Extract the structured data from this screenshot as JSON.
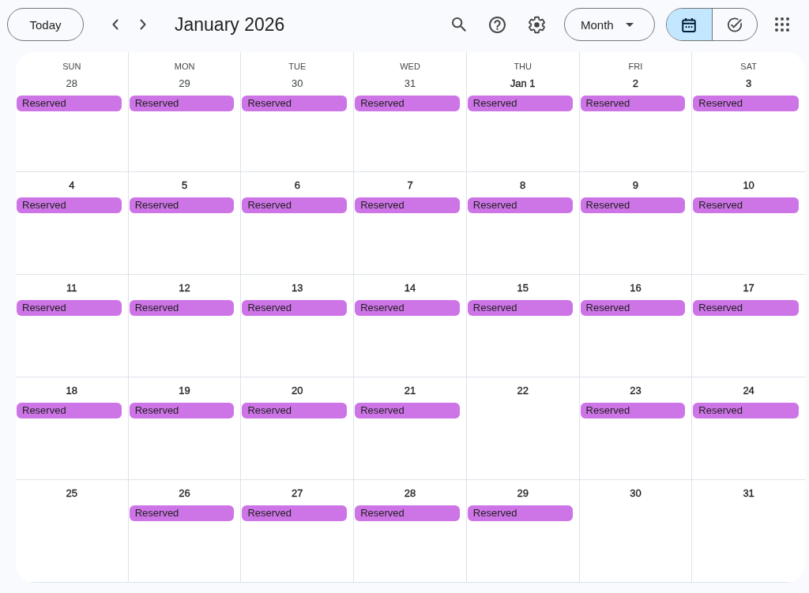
{
  "toolbar": {
    "today_button": "Today",
    "title": "January 2026",
    "view_dropdown": "Month",
    "view_toggle": [
      {
        "kind": "calendar",
        "selected": true
      },
      {
        "kind": "tasks",
        "selected": false
      }
    ]
  },
  "month_grid": {
    "weekdays": [
      "SUN",
      "MON",
      "TUE",
      "WED",
      "THU",
      "FRI",
      "SAT"
    ],
    "weeks": [
      [
        {
          "date": "28",
          "in_month": false,
          "events": [
            "Reserved"
          ]
        },
        {
          "date": "29",
          "in_month": false,
          "events": [
            "Reserved"
          ]
        },
        {
          "date": "30",
          "in_month": false,
          "events": [
            "Reserved"
          ]
        },
        {
          "date": "31",
          "in_month": false,
          "events": [
            "Reserved"
          ]
        },
        {
          "date": "Jan 1",
          "in_month": true,
          "events": [
            "Reserved"
          ]
        },
        {
          "date": "2",
          "in_month": true,
          "events": [
            "Reserved"
          ]
        },
        {
          "date": "3",
          "in_month": true,
          "events": [
            "Reserved"
          ]
        }
      ],
      [
        {
          "date": "4",
          "in_month": true,
          "events": [
            "Reserved"
          ]
        },
        {
          "date": "5",
          "in_month": true,
          "events": [
            "Reserved"
          ]
        },
        {
          "date": "6",
          "in_month": true,
          "events": [
            "Reserved"
          ]
        },
        {
          "date": "7",
          "in_month": true,
          "events": [
            "Reserved"
          ]
        },
        {
          "date": "8",
          "in_month": true,
          "events": [
            "Reserved"
          ]
        },
        {
          "date": "9",
          "in_month": true,
          "events": [
            "Reserved"
          ]
        },
        {
          "date": "10",
          "in_month": true,
          "events": [
            "Reserved"
          ]
        }
      ],
      [
        {
          "date": "11",
          "in_month": true,
          "events": [
            "Reserved"
          ]
        },
        {
          "date": "12",
          "in_month": true,
          "events": [
            "Reserved"
          ]
        },
        {
          "date": "13",
          "in_month": true,
          "events": [
            "Reserved"
          ]
        },
        {
          "date": "14",
          "in_month": true,
          "events": [
            "Reserved"
          ]
        },
        {
          "date": "15",
          "in_month": true,
          "events": [
            "Reserved"
          ]
        },
        {
          "date": "16",
          "in_month": true,
          "events": [
            "Reserved"
          ]
        },
        {
          "date": "17",
          "in_month": true,
          "events": [
            "Reserved"
          ]
        }
      ],
      [
        {
          "date": "18",
          "in_month": true,
          "events": [
            "Reserved"
          ]
        },
        {
          "date": "19",
          "in_month": true,
          "events": [
            "Reserved"
          ]
        },
        {
          "date": "20",
          "in_month": true,
          "events": [
            "Reserved"
          ]
        },
        {
          "date": "21",
          "in_month": true,
          "events": [
            "Reserved"
          ]
        },
        {
          "date": "22",
          "in_month": true
        },
        {
          "date": "23",
          "in_month": true,
          "events": [
            "Reserved"
          ]
        },
        {
          "date": "24",
          "in_month": true,
          "events": [
            "Reserved"
          ]
        }
      ],
      [
        {
          "date": "25",
          "in_month": true
        },
        {
          "date": "26",
          "in_month": true,
          "events": [
            "Reserved"
          ]
        },
        {
          "date": "27",
          "in_month": true,
          "events": [
            "Reserved"
          ]
        },
        {
          "date": "28",
          "in_month": true,
          "events": [
            "Reserved"
          ]
        },
        {
          "date": "29",
          "in_month": true,
          "events": [
            "Reserved"
          ]
        },
        {
          "date": "30",
          "in_month": true
        },
        {
          "date": "31",
          "in_month": true
        }
      ]
    ]
  }
}
